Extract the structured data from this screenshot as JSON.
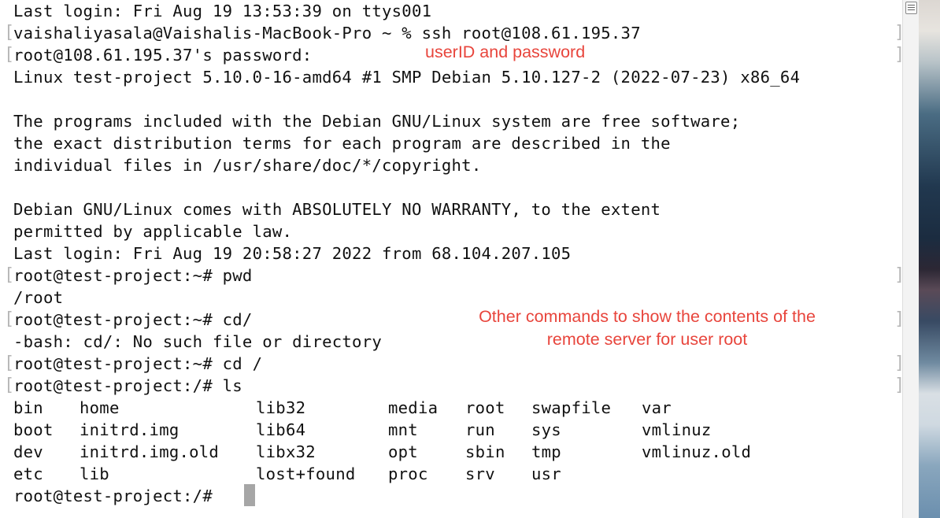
{
  "terminal": {
    "lines": {
      "l1": "Last login: Fri Aug 19 13:53:39 on ttys001",
      "l2": "vaishaliyasala@Vaishalis-MacBook-Pro ~ % ssh root@108.61.195.37",
      "l3": "root@108.61.195.37's password:",
      "l4": "Linux test-project 5.10.0-16-amd64 #1 SMP Debian 5.10.127-2 (2022-07-23) x86_64",
      "l5": "The programs included with the Debian GNU/Linux system are free software;",
      "l6": "the exact distribution terms for each program are described in the",
      "l7": "individual files in /usr/share/doc/*/copyright.",
      "l8": "Debian GNU/Linux comes with ABSOLUTELY NO WARRANTY, to the extent",
      "l9": "permitted by applicable law.",
      "l10": "Last login: Fri Aug 19 20:58:27 2022 from 68.104.207.105",
      "l11": "root@test-project:~# pwd",
      "l12": "/root",
      "l13": "root@test-project:~# cd/",
      "l14": "-bash: cd/: No such file or directory",
      "l15": "root@test-project:~# cd /",
      "l16": "root@test-project:/# ls",
      "prompt": "root@test-project:/# "
    },
    "ls_rows": [
      [
        "bin",
        "home",
        "lib32",
        "media",
        "root",
        "swapfile",
        "var"
      ],
      [
        "boot",
        "initrd.img",
        "lib64",
        "mnt",
        "run",
        "sys",
        "vmlinuz"
      ],
      [
        "dev",
        "initrd.img.old",
        "libx32",
        "opt",
        "sbin",
        "tmp",
        "vmlinuz.old"
      ],
      [
        "etc",
        "lib",
        "lost+found",
        "proc",
        "srv",
        "usr",
        ""
      ]
    ],
    "mark_left": "[",
    "mark_right": "]"
  },
  "annotations": {
    "credentials": "userID and password",
    "commands_1": "Other commands to show the contents of the",
    "commands_2": "remote server for user root"
  },
  "colors": {
    "annotation": "#e8453c",
    "text": "#111111",
    "cursor": "#a6a6a6"
  }
}
